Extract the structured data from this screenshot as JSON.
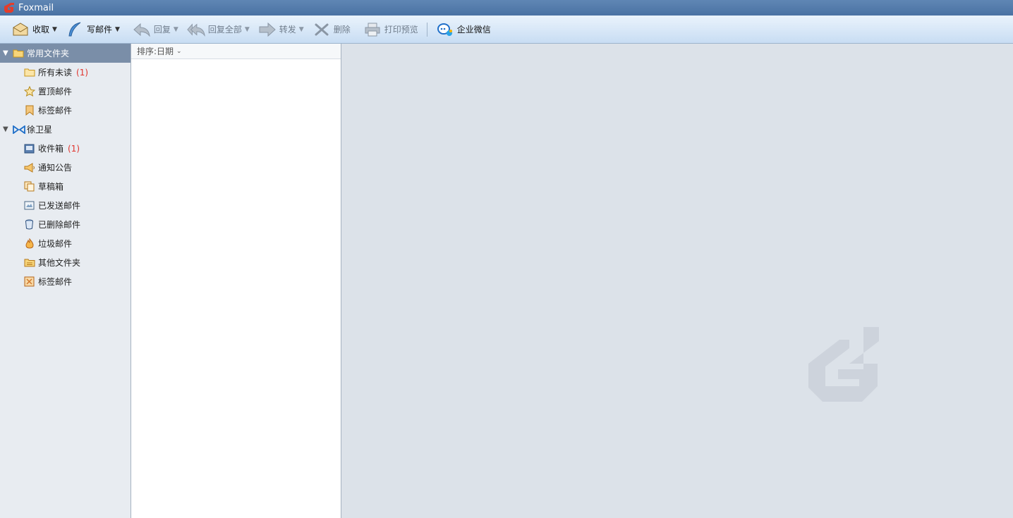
{
  "window": {
    "title": "Foxmail"
  },
  "toolbar": {
    "receive": "收取",
    "compose": "写邮件",
    "reply": "回复",
    "reply_all": "回复全部",
    "forward": "转发",
    "delete": "删除",
    "print_preview": "打印预览",
    "wework": "企业微信",
    "dropdown_glyph": "▼"
  },
  "sidebar": {
    "common": {
      "label": "常用文件夹",
      "items": [
        {
          "label": "所有未读",
          "badge": "(1)",
          "icon": "folder-icon"
        },
        {
          "label": "置顶邮件",
          "icon": "star-icon"
        },
        {
          "label": "标签邮件",
          "icon": "bookmark-icon"
        }
      ]
    },
    "account": {
      "label": "徐卫星",
      "items": [
        {
          "label": "收件箱",
          "badge": "(1)",
          "icon": "inbox-icon"
        },
        {
          "label": "通知公告",
          "icon": "megaphone-icon"
        },
        {
          "label": "草稿箱",
          "icon": "drafts-icon"
        },
        {
          "label": "已发送邮件",
          "icon": "sent-icon"
        },
        {
          "label": "已删除邮件",
          "icon": "trash-icon"
        },
        {
          "label": "垃圾邮件",
          "icon": "junk-icon"
        },
        {
          "label": "其他文件夹",
          "icon": "other-folder-icon"
        },
        {
          "label": "标签邮件",
          "icon": "tag-icon"
        }
      ]
    }
  },
  "maillist": {
    "sort_label": "排序:日期"
  },
  "colors": {
    "titlebar": "#4a72a3",
    "selected_group": "#7a8ea8",
    "badge": "#e0342d"
  }
}
